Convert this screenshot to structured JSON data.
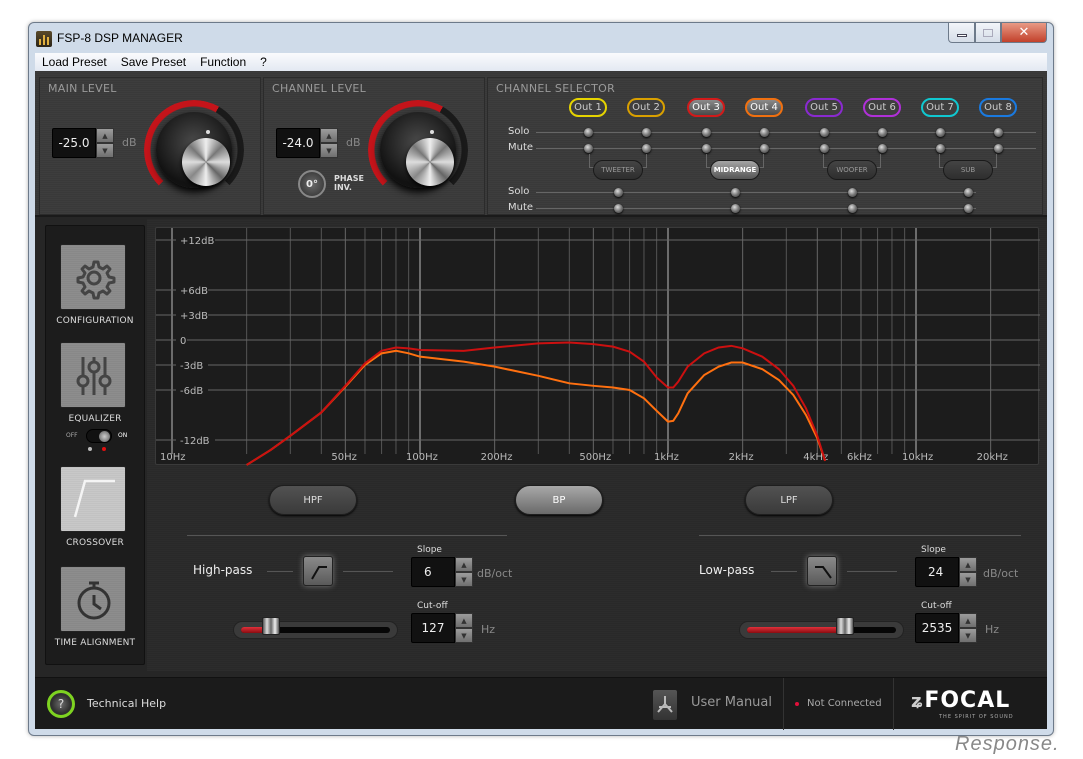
{
  "window": {
    "title": "FSP-8 DSP MANAGER",
    "minimize": "—",
    "maximize": "▭",
    "close": "✕"
  },
  "menu": [
    "Load Preset",
    "Save Preset",
    "Function",
    "?"
  ],
  "main_level": {
    "label": "MAIN LEVEL",
    "value": "-25.0",
    "unit": "dB",
    "knob_level_fraction": 0.62
  },
  "channel_level": {
    "label": "CHANNEL LEVEL",
    "value": "-24.0",
    "unit": "dB",
    "knob_level_fraction": 0.64,
    "phase_value": "0°",
    "phase_label_1": "PHASE",
    "phase_label_2": "INV."
  },
  "channel_selector": {
    "label": "CHANNEL SELECTOR",
    "outputs": [
      {
        "label": "Out 1",
        "color": "#e6d400",
        "active": false
      },
      {
        "label": "Out 2",
        "color": "#d9a000",
        "active": false
      },
      {
        "label": "Out 3",
        "color": "#d21a1a",
        "active": true
      },
      {
        "label": "Out 4",
        "color": "#f07010",
        "active": true
      },
      {
        "label": "Out 5",
        "color": "#8a2ad0",
        "active": false
      },
      {
        "label": "Out 6",
        "color": "#b030d8",
        "active": false
      },
      {
        "label": "Out 7",
        "color": "#10c8d0",
        "active": false
      },
      {
        "label": "Out 8",
        "color": "#1a7ae0",
        "active": false
      }
    ],
    "solo_label": "Solo",
    "mute_label": "Mute",
    "groups": [
      {
        "label": "TWEETER",
        "active": false
      },
      {
        "label": "MIDRANGE",
        "active": true
      },
      {
        "label": "WOOFER",
        "active": false
      },
      {
        "label": "SUB",
        "active": false
      }
    ]
  },
  "sidebar": {
    "items": [
      {
        "label": "CONFIGURATION",
        "icon": "gear-icon",
        "active": false
      },
      {
        "label": "EQUALIZER",
        "icon": "sliders-icon",
        "active": false
      },
      {
        "label": "CROSSOVER",
        "icon": "crossover-icon",
        "active": true
      },
      {
        "label": "TIME ALIGNMENT",
        "icon": "stopwatch-icon",
        "active": false
      }
    ],
    "eq_toggle": {
      "off_label": "OFF",
      "on_label": "ON",
      "state": "on"
    }
  },
  "chart_data": {
    "type": "line",
    "title": "",
    "xscale": "log",
    "xlim": [
      10,
      30000
    ],
    "ylim": [
      -12,
      12
    ],
    "x_ticks": [
      {
        "value": 10,
        "label": "10Hz"
      },
      {
        "value": 50,
        "label": "50Hz"
      },
      {
        "value": 100,
        "label": "100Hz"
      },
      {
        "value": 200,
        "label": "200Hz"
      },
      {
        "value": 500,
        "label": "500Hz"
      },
      {
        "value": 1000,
        "label": "1kHz"
      },
      {
        "value": 2000,
        "label": "2kHz"
      },
      {
        "value": 4000,
        "label": "4kHz"
      },
      {
        "value": 6000,
        "label": "6kHz"
      },
      {
        "value": 10000,
        "label": "10kHz"
      },
      {
        "value": 20000,
        "label": "20kHz"
      }
    ],
    "y_ticks": [
      {
        "value": 12,
        "label": "+12dB"
      },
      {
        "value": 6,
        "label": "+6dB"
      },
      {
        "value": 3,
        "label": "+3dB"
      },
      {
        "value": 0,
        "label": "0"
      },
      {
        "value": -3,
        "label": "-3dB"
      },
      {
        "value": -6,
        "label": "-6dB"
      },
      {
        "value": -12,
        "label": "-12dB"
      }
    ],
    "grid": true,
    "series": [
      {
        "name": "Out 3",
        "color": "#cc1010",
        "x": [
          20,
          25,
          30,
          40,
          50,
          60,
          70,
          80,
          90,
          100,
          150,
          200,
          300,
          400,
          500,
          600,
          700,
          800,
          900,
          1000,
          1050,
          1100,
          1200,
          1400,
          1600,
          1800,
          2000,
          2400,
          2800,
          3200,
          3600,
          4000,
          4300
        ],
        "y": [
          -15,
          -13.2,
          -11.5,
          -8.7,
          -5.5,
          -2.8,
          -1.3,
          -0.9,
          -1.0,
          -1.2,
          -1.3,
          -0.9,
          -0.4,
          -0.3,
          -0.5,
          -0.8,
          -1.4,
          -2.6,
          -4.5,
          -5.7,
          -5.7,
          -5.0,
          -3.2,
          -1.6,
          -0.9,
          -0.7,
          -1.0,
          -2.0,
          -3.5,
          -5.5,
          -8.2,
          -11.5,
          -14.5
        ]
      },
      {
        "name": "Out 4",
        "color": "#ff7010",
        "x": [
          20,
          25,
          30,
          40,
          50,
          60,
          70,
          80,
          90,
          100,
          150,
          200,
          300,
          400,
          500,
          600,
          700,
          800,
          900,
          1000,
          1050,
          1100,
          1200,
          1400,
          1600,
          1800,
          2000,
          2400,
          2800,
          3200,
          3600,
          4000,
          4300
        ],
        "y": [
          -15,
          -13.2,
          -11.5,
          -8.7,
          -5.6,
          -3.0,
          -1.6,
          -1.3,
          -1.6,
          -2.0,
          -2.6,
          -3.2,
          -4.3,
          -5.2,
          -5.5,
          -5.7,
          -6.0,
          -7.0,
          -8.5,
          -9.8,
          -9.7,
          -8.8,
          -6.4,
          -4.2,
          -3.2,
          -2.7,
          -2.7,
          -3.5,
          -4.8,
          -6.6,
          -9.0,
          -11.8,
          -14.5
        ]
      }
    ]
  },
  "crossover": {
    "modes": [
      {
        "label": "HPF",
        "active": false
      },
      {
        "label": "BP",
        "active": true
      },
      {
        "label": "LPF",
        "active": false
      }
    ],
    "high_pass": {
      "label": "High-pass",
      "slope_label": "Slope",
      "slope_value": "6",
      "slope_unit": "dB/oct",
      "cutoff_label": "Cut-off",
      "cutoff_value": "127",
      "cutoff_unit": "Hz",
      "slider_fraction": 0.2
    },
    "low_pass": {
      "label": "Low-pass",
      "slope_label": "Slope",
      "slope_value": "24",
      "slope_unit": "dB/oct",
      "cutoff_label": "Cut-off",
      "cutoff_value": "2535",
      "cutoff_unit": "Hz",
      "slider_fraction": 0.65
    }
  },
  "footer": {
    "help_symbol": "?",
    "help_label": "Technical Help",
    "manual_label": "User Manual",
    "status_label": "Not Connected",
    "status_color": "#e0103a",
    "brand": "FOCAL",
    "brand_tagline": "THE SPIRIT OF SOUND"
  },
  "watermark": "Response."
}
